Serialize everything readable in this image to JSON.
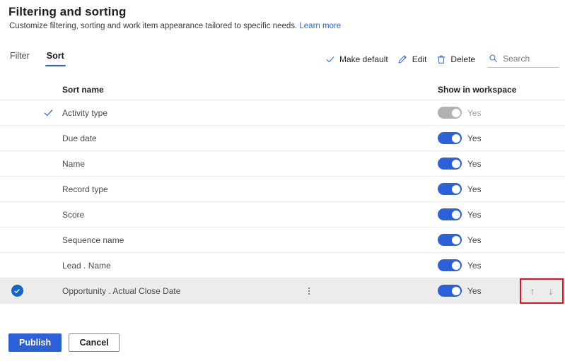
{
  "header": {
    "title": "Filtering and sorting",
    "subtitle": "Customize filtering, sorting and work item appearance tailored to specific needs.",
    "learn_more": "Learn more"
  },
  "tabs": [
    {
      "label": "Filter",
      "active": false
    },
    {
      "label": "Sort",
      "active": true
    }
  ],
  "commandbar": {
    "make_default": "Make default",
    "edit": "Edit",
    "delete": "Delete",
    "search_placeholder": "Search",
    "search_value": ""
  },
  "table": {
    "columns": {
      "sort_name": "Sort name",
      "show_in_workspace": "Show in workspace"
    },
    "rows": [
      {
        "name": "Activity type",
        "is_default": true,
        "selected": false,
        "toggle_on": true,
        "toggle_disabled": true,
        "toggle_label": "Yes"
      },
      {
        "name": "Due date",
        "is_default": false,
        "selected": false,
        "toggle_on": true,
        "toggle_disabled": false,
        "toggle_label": "Yes"
      },
      {
        "name": "Name",
        "is_default": false,
        "selected": false,
        "toggle_on": true,
        "toggle_disabled": false,
        "toggle_label": "Yes"
      },
      {
        "name": "Record type",
        "is_default": false,
        "selected": false,
        "toggle_on": true,
        "toggle_disabled": false,
        "toggle_label": "Yes"
      },
      {
        "name": "Score",
        "is_default": false,
        "selected": false,
        "toggle_on": true,
        "toggle_disabled": false,
        "toggle_label": "Yes"
      },
      {
        "name": "Sequence name",
        "is_default": false,
        "selected": false,
        "toggle_on": true,
        "toggle_disabled": false,
        "toggle_label": "Yes"
      },
      {
        "name": "Lead . Name",
        "is_default": false,
        "selected": false,
        "toggle_on": true,
        "toggle_disabled": false,
        "toggle_label": "Yes"
      },
      {
        "name": "Opportunity . Actual Close Date",
        "is_default": false,
        "selected": true,
        "toggle_on": true,
        "toggle_disabled": false,
        "toggle_label": "Yes"
      }
    ]
  },
  "row_actions": {
    "move_up": "↑",
    "move_down": "↓",
    "overflow": "more-options"
  },
  "footer": {
    "publish": "Publish",
    "cancel": "Cancel"
  },
  "icons": {
    "make_default": "checkmark-icon",
    "edit": "pencil-icon",
    "delete": "trash-icon",
    "search": "search-icon",
    "default_row": "checkmark-icon",
    "selected_row": "checkbox-circle-checked-icon",
    "overflow": "more-vertical-icon",
    "move_up": "arrow-up-icon",
    "move_down": "arrow-down-icon"
  },
  "colors": {
    "accent_blue": "#2b60d8",
    "link_blue": "#2c62d0",
    "selected_checkbox_blue": "#1467c8",
    "toggle_on": "#2b60d8",
    "toggle_disabled": "#b3b0ad",
    "annotation_red": "#e81123",
    "row_selected_bg": "#ececeb",
    "row_divider": "#edebe9"
  }
}
